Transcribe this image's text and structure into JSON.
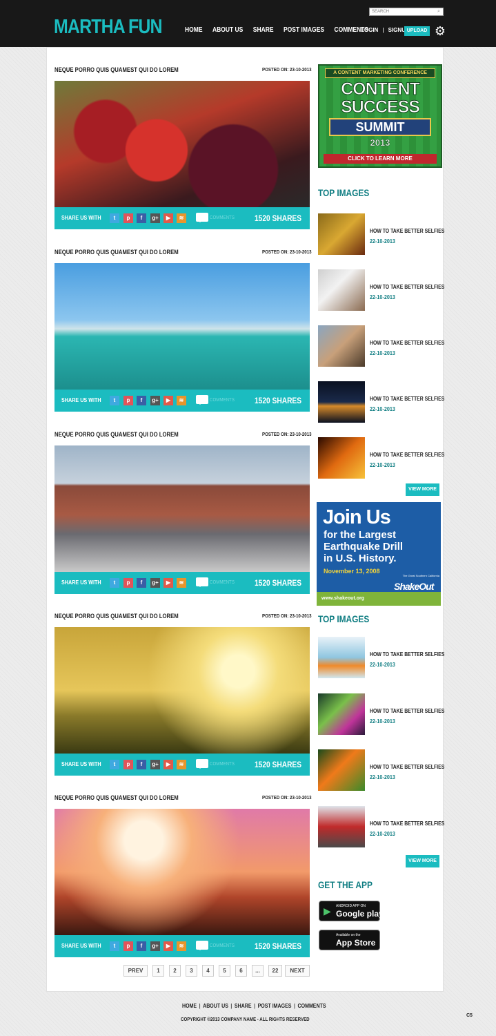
{
  "header": {
    "logo": "MARTHA FUN",
    "search_placeholder": "SEARCH",
    "nav": [
      "HOME",
      "ABOUT US",
      "SHARE",
      "POST IMAGES",
      "COMMENTS"
    ],
    "login": "LOGIN",
    "signup": "SIGNUP",
    "upload": "UPLOAD"
  },
  "posts": [
    {
      "title": "NEQUE PORRO  QUIS QUAMEST QUI DO LOREM",
      "date": "POSTED ON: 23-10-2013",
      "image": "fruit market photo",
      "share_label": "SHARE US WITH",
      "comments": "COMMENTS",
      "shares": "1520 SHARES"
    },
    {
      "title": "NEQUE PORRO  QUIS QUAMEST QUI DO LOREM",
      "date": "POSTED ON: 23-10-2013",
      "image": "harbor with yachts photo",
      "share_label": "SHARE US WITH",
      "comments": "COMMENTS",
      "shares": "1520 SHARES"
    },
    {
      "title": "NEQUE PORRO  QUIS QUAMEST QUI DO LOREM",
      "date": "POSTED ON: 23-10-2013",
      "image": "city street photo",
      "share_label": "SHARE US WITH",
      "comments": "COMMENTS",
      "shares": "1520 SHARES"
    },
    {
      "title": "NEQUE PORRO  QUIS QUAMEST QUI DO LOREM",
      "date": "POSTED ON: 23-10-2013",
      "image": "wine at sunset photo",
      "share_label": "SHARE US WITH",
      "comments": "COMMENTS",
      "shares": "1520 SHARES"
    },
    {
      "title": "NEQUE PORRO  QUIS QUAMEST QUI DO LOREM",
      "date": "POSTED ON: 23-10-2013",
      "image": "yoga silhouette photo",
      "share_label": "SHARE US WITH",
      "comments": "COMMENTS",
      "shares": "1520 SHARES"
    }
  ],
  "social_icons": [
    {
      "name": "twitter-icon",
      "glyph": "t",
      "color": "#3fa9e0"
    },
    {
      "name": "pinterest-icon",
      "glyph": "p",
      "color": "#e0545a"
    },
    {
      "name": "facebook-icon",
      "glyph": "f",
      "color": "#3a5ea5"
    },
    {
      "name": "googleplus-icon",
      "glyph": "g+",
      "color": "#555555"
    },
    {
      "name": "youtube-icon",
      "glyph": "▶",
      "color": "#e05a4a"
    },
    {
      "name": "rss-icon",
      "glyph": "≋",
      "color": "#e8952c"
    }
  ],
  "pagination": [
    "PREV",
    "1",
    "2",
    "3",
    "4",
    "5",
    "6",
    "...",
    "22",
    "NEXT"
  ],
  "ad_top": {
    "line1": "A CONTENT MARKETING CONFERENCE",
    "line2": "CONTENT",
    "line3": "SUCCESS",
    "line4": "SUMMIT",
    "line5": "2013",
    "cta": "CLICK TO LEARN MORE"
  },
  "sidebar_top1": {
    "heading": "TOP IMAGES",
    "items": [
      {
        "title": "HOW TO TAKE BETTER SELFIES",
        "date": "22-10-2013"
      },
      {
        "title": "HOW TO TAKE BETTER SELFIES",
        "date": "22-10-2013"
      },
      {
        "title": "HOW TO TAKE BETTER SELFIES",
        "date": "22-10-2013"
      },
      {
        "title": "HOW TO TAKE BETTER SELFIES",
        "date": "22-10-2013"
      },
      {
        "title": "HOW TO TAKE BETTER SELFIES",
        "date": "22-10-2013"
      }
    ],
    "view_more": "VIEW MORE"
  },
  "ad_mid": {
    "title": "Join Us",
    "line1": "for the Largest",
    "line2": "Earthquake Drill",
    "line3": "in U.S. History.",
    "date": "November 13, 2008",
    "url": "www.shakeout.org",
    "brand_small": "The Great Southern California",
    "brand": "ShakeOut"
  },
  "sidebar_top2": {
    "heading": "TOP IMAGES",
    "items": [
      {
        "title": "HOW TO TAKE BETTER SELFIES",
        "date": "22-10-2013"
      },
      {
        "title": "HOW TO TAKE BETTER SELFIES",
        "date": "22-10-2013"
      },
      {
        "title": "HOW TO TAKE BETTER SELFIES",
        "date": "22-10-2013"
      },
      {
        "title": "HOW TO TAKE BETTER SELFIES",
        "date": "22-10-2013"
      }
    ],
    "view_more": "VIEW MORE"
  },
  "app": {
    "heading": "GET THE APP",
    "google_small": "ANDROID APP ON",
    "google_big": "Google play",
    "apple_small": "Available on the",
    "apple_big": "App Store"
  },
  "footer": {
    "nav": [
      "HOME",
      "ABOUT US",
      "SHARE",
      "POST IMAGES",
      "COMMENTS"
    ],
    "copyright": "COPYRIGHT ©2013 COMPANY NAME  - ALL RIGHTS RESERVED",
    "badge": "C5"
  },
  "colors": {
    "accent": "#1bbcc0",
    "header": "#181818",
    "heading": "#0f7d82"
  }
}
